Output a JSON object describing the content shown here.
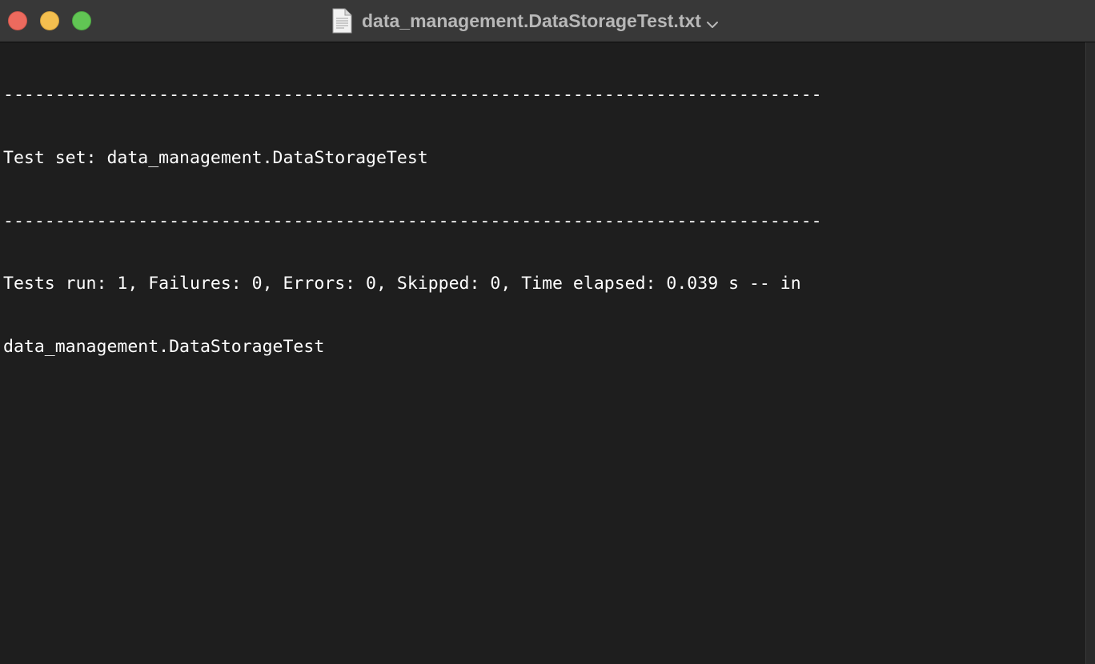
{
  "window": {
    "title": "data_management.DataStorageTest.txt",
    "title_icon": "document-icon",
    "title_menu_icon": "chevron-down-icon",
    "traffic_lights": {
      "close_color": "#ec6a5e",
      "minimize_color": "#f4bf4f",
      "maximize_color": "#61c554"
    }
  },
  "document": {
    "lines": [
      "-------------------------------------------------------------------------------",
      "Test set: data_management.DataStorageTest",
      "-------------------------------------------------------------------------------",
      "Tests run: 1, Failures: 0, Errors: 0, Skipped: 0, Time elapsed: 0.039 s -- in",
      "data_management.DataStorageTest"
    ]
  }
}
